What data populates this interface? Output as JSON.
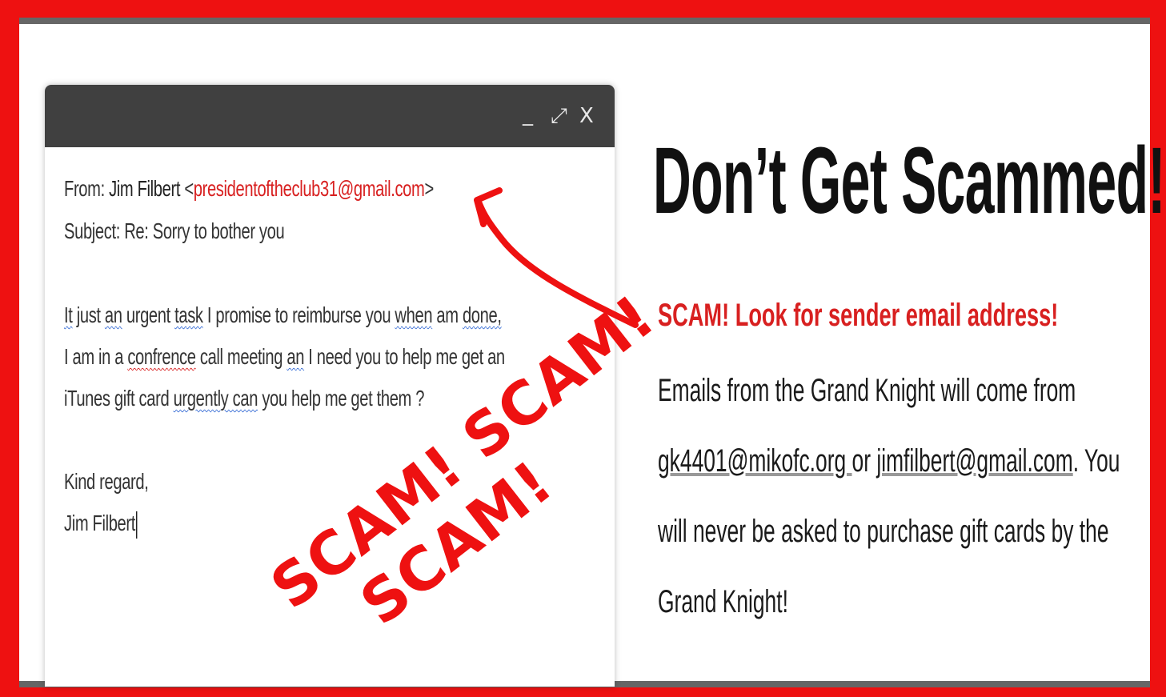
{
  "window_controls": {
    "minimize": "_",
    "maximize": "⤢",
    "close": "X"
  },
  "email": {
    "from_label": "From:",
    "sender_name": "Jim Filbert",
    "sender_email_open": "<",
    "sender_email": "presidentoftheclub31@gmail.com",
    "sender_email_close": ">",
    "subject_label": "Subject:",
    "subject": "Re: Sorry to bother you",
    "body": {
      "l1": [
        "It",
        " just ",
        "an",
        " urgent ",
        "task",
        " I promise to reimburse you ",
        "when",
        " am ",
        "done,"
      ],
      "l2": [
        "I am in a ",
        "confrence",
        " call meeting ",
        "an",
        " I need you to help me get an"
      ],
      "l3": [
        "iTunes gift card ",
        "urgently can",
        " you help me get them ?"
      ],
      "closing": "Kind regard,",
      "signature": "Jim Filbert"
    }
  },
  "stamp": {
    "line1": "SCAM! SCAM!",
    "line2": "SCAM!"
  },
  "notice": {
    "headline": "Don’t Get Scammed!",
    "warning": "SCAM! Look for sender email address!",
    "line1": "Emails from the Grand Knight will come from",
    "link1": "gk4401@mikofc.org ",
    "or": "or ",
    "link2": "jimfilbert@gmail.com",
    "line2_tail": ". You",
    "line3": "will never be asked to purchase gift cards by the",
    "line4": "Grand Knight!"
  },
  "colors": {
    "frame": "#ee1111",
    "titlebar": "#404040",
    "accent_red": "#d82020"
  },
  "icons": [
    "minimize-icon",
    "maximize-icon",
    "close-icon",
    "arrow-annotation"
  ]
}
